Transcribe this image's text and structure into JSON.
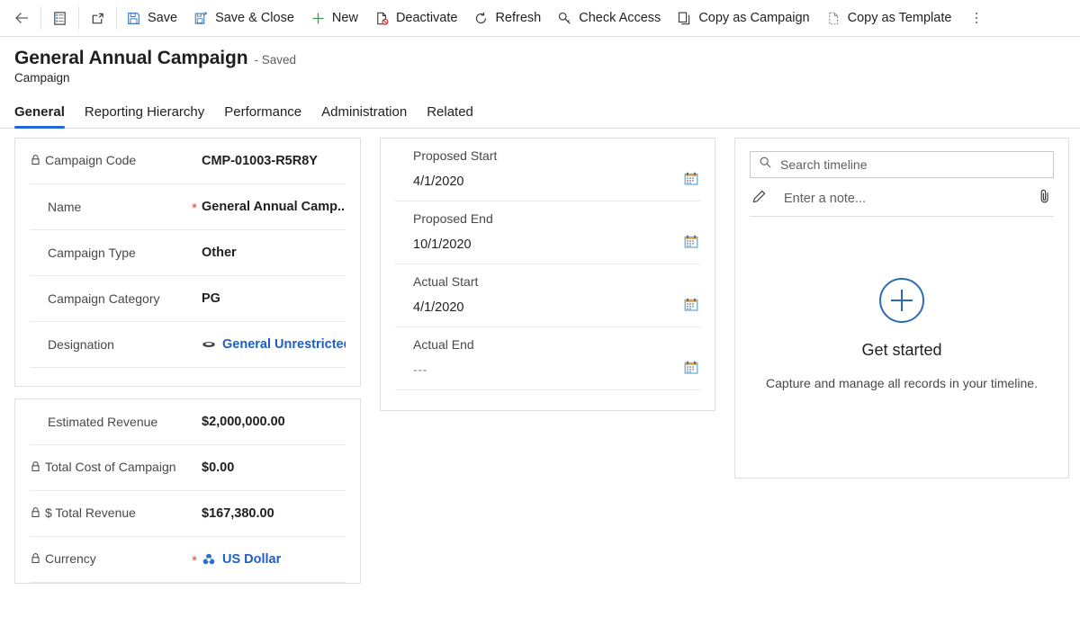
{
  "commandbar": {
    "items": [
      {
        "name": "back",
        "icon": "back-arrow-icon",
        "label": ""
      },
      {
        "name": "form-selector",
        "icon": "form-list-icon",
        "label": ""
      },
      {
        "name": "popout",
        "icon": "popout-icon",
        "label": ""
      },
      {
        "name": "save",
        "icon": "save-icon",
        "label": "Save"
      },
      {
        "name": "save-close",
        "icon": "save-and-close-icon",
        "label": "Save & Close"
      },
      {
        "name": "new",
        "icon": "plus-icon",
        "label": "New"
      },
      {
        "name": "deactivate",
        "icon": "deactivate-icon",
        "label": "Deactivate"
      },
      {
        "name": "refresh",
        "icon": "refresh-icon",
        "label": "Refresh"
      },
      {
        "name": "check-access",
        "icon": "key-icon",
        "label": "Check Access"
      },
      {
        "name": "copy-campaign",
        "icon": "copy-icon",
        "label": "Copy as Campaign"
      },
      {
        "name": "copy-template",
        "icon": "template-icon",
        "label": "Copy as Template"
      },
      {
        "name": "overflow",
        "icon": "more-vertical-icon",
        "label": ""
      }
    ]
  },
  "header": {
    "title": "General Annual Campaign",
    "saved_status": "- Saved",
    "entity": "Campaign"
  },
  "tabs": [
    {
      "label": "General",
      "active": true
    },
    {
      "label": "Reporting Hierarchy",
      "active": false
    },
    {
      "label": "Performance",
      "active": false
    },
    {
      "label": "Administration",
      "active": false
    },
    {
      "label": "Related",
      "active": false
    }
  ],
  "summary_card": {
    "fields": [
      {
        "label": "Campaign Code",
        "value": "CMP-01003-R5R8Y",
        "locked": true,
        "required": false,
        "link": false,
        "icon": ""
      },
      {
        "label": "Name",
        "value": "General Annual Camp...",
        "locked": false,
        "required": true,
        "link": false,
        "icon": ""
      },
      {
        "label": "Campaign Type",
        "value": "Other",
        "locked": false,
        "required": false,
        "link": false,
        "icon": ""
      },
      {
        "label": "Campaign Category",
        "value": "PG",
        "locked": false,
        "required": false,
        "link": false,
        "icon": ""
      },
      {
        "label": "Designation",
        "value": "General Unrestricted",
        "locked": false,
        "required": false,
        "link": true,
        "icon": "entity-lookup-icon"
      }
    ]
  },
  "financial_card": {
    "fields": [
      {
        "label": "Estimated Revenue",
        "value": "$2,000,000.00",
        "locked": false,
        "required": false,
        "link": false,
        "icon": ""
      },
      {
        "label": "Total Cost of Campaign",
        "value": "$0.00",
        "locked": true,
        "required": false,
        "link": false,
        "icon": ""
      },
      {
        "label": "$ Total Revenue",
        "value": "$167,380.00",
        "locked": true,
        "required": false,
        "link": false,
        "icon": ""
      },
      {
        "label": "Currency",
        "value": "US Dollar",
        "locked": true,
        "required": true,
        "link": true,
        "icon": "currency-icon"
      }
    ]
  },
  "schedule_card": {
    "fields": [
      {
        "label": "Proposed Start",
        "value": "4/1/2020",
        "empty": false
      },
      {
        "label": "Proposed End",
        "value": "10/1/2020",
        "empty": false
      },
      {
        "label": "Actual Start",
        "value": "4/1/2020",
        "empty": false
      },
      {
        "label": "Actual End",
        "value": "---",
        "empty": true
      }
    ]
  },
  "timeline": {
    "search_placeholder": "Search timeline",
    "note_placeholder": "Enter a note...",
    "empty_title": "Get started",
    "empty_caption": "Capture and manage all records in your timeline."
  },
  "colors": {
    "accent": "#2266dd",
    "link": "#1f5fc4",
    "required": "#d64b4b",
    "border": "#e1dfdd"
  }
}
